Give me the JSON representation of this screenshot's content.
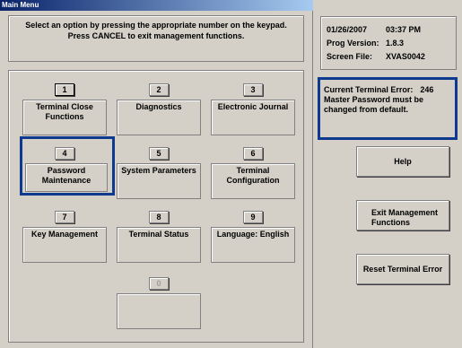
{
  "window": {
    "title": "Main Menu"
  },
  "instructions": {
    "line1": "Select an option by pressing the appropriate number on the keypad.",
    "line2": "Press CANCEL to exit management functions."
  },
  "options": [
    {
      "number": "1",
      "label": "Terminal Close Functions"
    },
    {
      "number": "2",
      "label": "Diagnostics"
    },
    {
      "number": "3",
      "label": "Electronic Journal"
    },
    {
      "number": "4",
      "label": "Password Maintenance"
    },
    {
      "number": "5",
      "label": "System Parameters"
    },
    {
      "number": "6",
      "label": "Terminal Configuration"
    },
    {
      "number": "7",
      "label": "Key Management"
    },
    {
      "number": "8",
      "label": "Terminal Status"
    },
    {
      "number": "9",
      "label": "Language: English"
    },
    {
      "number": "0",
      "label": ""
    }
  ],
  "info": {
    "date": "01/26/2007",
    "time": "03:37 PM",
    "prog_version_label": "Prog Version:",
    "prog_version": "1.8.3",
    "screen_file_label": "Screen File:",
    "screen_file": "XVAS0042"
  },
  "error": {
    "label": "Current Terminal Error:",
    "code": "246",
    "message": "Master Password must be changed from default."
  },
  "buttons": {
    "help": "Help",
    "exit": "Exit Management Functions",
    "reset": "Reset Terminal Error"
  },
  "colors": {
    "highlight": "#0d3a8f",
    "panel": "#d4d0c8"
  }
}
